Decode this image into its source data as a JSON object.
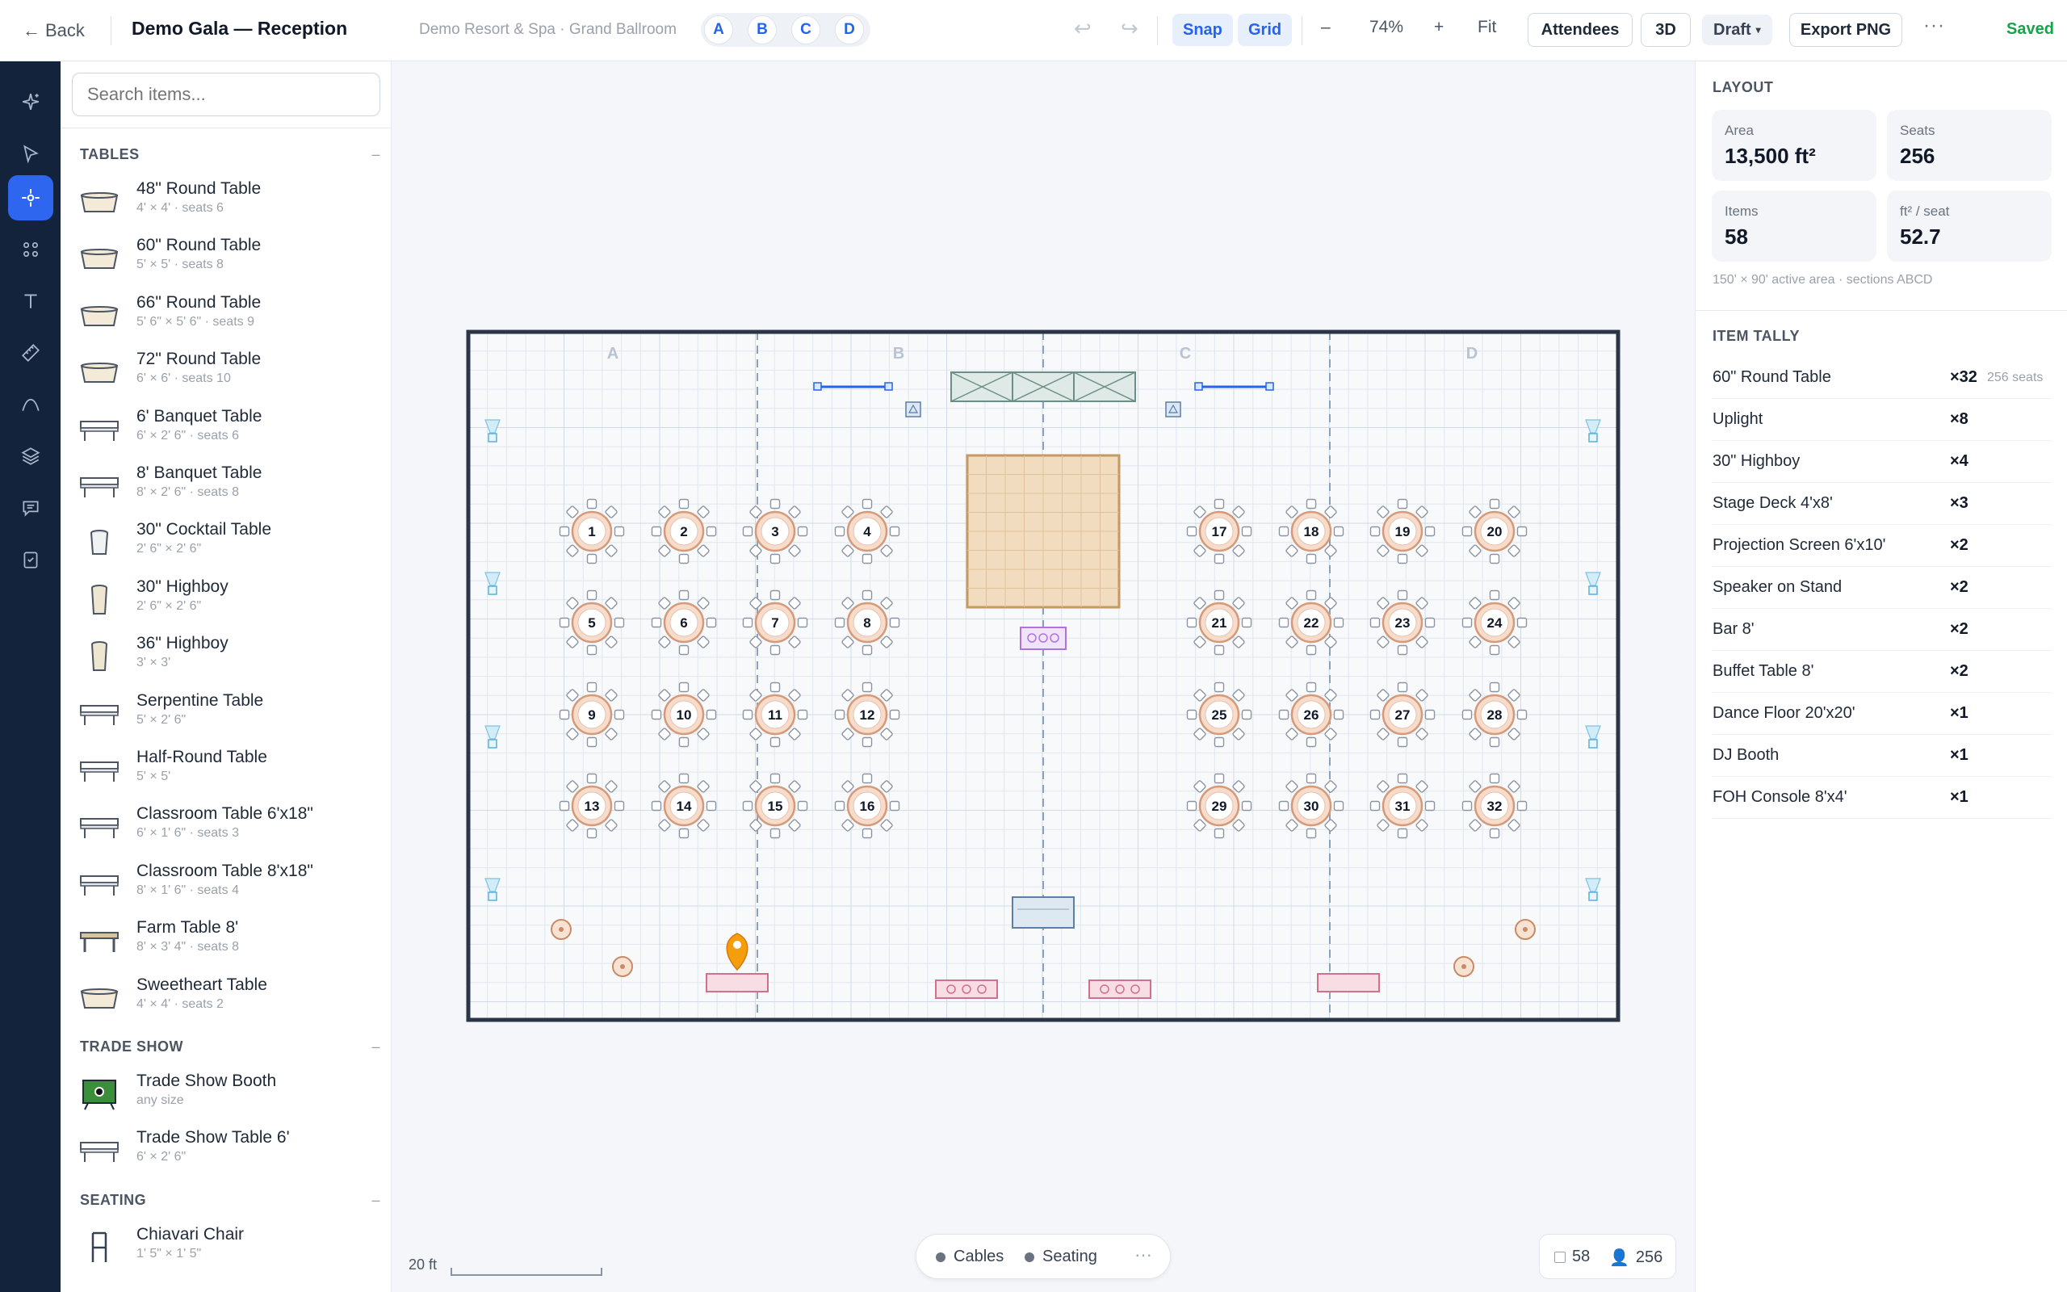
{
  "topbar": {
    "back_label": "Back",
    "title": "Demo Gala — Reception",
    "venue": "Demo Resort & Spa · Grand Ballroom",
    "sections": [
      "A",
      "B",
      "C",
      "D"
    ],
    "snap_label": "Snap",
    "grid_label": "Grid",
    "zoom_out": "–",
    "zoom_level": "74%",
    "zoom_in": "+",
    "fit_label": "Fit",
    "attendees_label": "Attendees",
    "view3d_label": "3D",
    "status_label": "Draft",
    "export_label": "Export PNG",
    "more": "···",
    "saved_label": "Saved"
  },
  "rail": {
    "items": [
      {
        "icon": "sparkle-icon",
        "active": false
      },
      {
        "icon": "cursor-icon",
        "active": false
      },
      {
        "icon": "items-icon",
        "active": true
      },
      {
        "icon": "groups-icon",
        "active": false
      },
      {
        "icon": "text-icon",
        "active": false
      },
      {
        "icon": "measure-icon",
        "active": false
      },
      {
        "icon": "path-icon",
        "active": false
      },
      {
        "icon": "layers-icon",
        "active": false
      },
      {
        "icon": "comments-icon",
        "active": false
      },
      {
        "icon": "checklist-icon",
        "active": false
      }
    ]
  },
  "library": {
    "search_placeholder": "Search items...",
    "categories": [
      {
        "name": "TABLES",
        "items": [
          {
            "name": "48\" Round Table",
            "sub": "4' × 4' · seats 6",
            "icon": "round"
          },
          {
            "name": "60\" Round Table",
            "sub": "5' × 5' · seats 8",
            "icon": "round"
          },
          {
            "name": "66\" Round Table",
            "sub": "5' 6\" × 5' 6\" · seats 9",
            "icon": "round"
          },
          {
            "name": "72\" Round Table",
            "sub": "6' × 6' · seats 10",
            "icon": "round"
          },
          {
            "name": "6' Banquet Table",
            "sub": "6' × 2' 6\" · seats 6",
            "icon": "banquet"
          },
          {
            "name": "8' Banquet Table",
            "sub": "8' × 2' 6\" · seats 8",
            "icon": "banquet"
          },
          {
            "name": "30\" Cocktail Table",
            "sub": "2' 6\" × 2' 6\"",
            "icon": "cocktail"
          },
          {
            "name": "30\" Highboy",
            "sub": "2' 6\" × 2' 6\"",
            "icon": "highboy"
          },
          {
            "name": "36\" Highboy",
            "sub": "3' × 3'",
            "icon": "highboy"
          },
          {
            "name": "Serpentine Table",
            "sub": "5' × 2' 6\"",
            "icon": "banquet"
          },
          {
            "name": "Half-Round Table",
            "sub": "5' × 5'",
            "icon": "banquet"
          },
          {
            "name": "Classroom Table 6'x18\"",
            "sub": "6' × 1' 6\" · seats 3",
            "icon": "banquet"
          },
          {
            "name": "Classroom Table 8'x18\"",
            "sub": "8' × 1' 6\" · seats 4",
            "icon": "banquet"
          },
          {
            "name": "Farm Table 8'",
            "sub": "8' × 3' 4\" · seats 8",
            "icon": "farm"
          },
          {
            "name": "Sweetheart Table",
            "sub": "4' × 4' · seats 2",
            "icon": "round"
          }
        ]
      },
      {
        "name": "TRADE SHOW",
        "items": [
          {
            "name": "Trade Show Booth",
            "sub": "any size",
            "icon": "booth"
          },
          {
            "name": "Trade Show Table 6'",
            "sub": "6' × 2' 6\"",
            "icon": "banquet"
          }
        ]
      },
      {
        "name": "SEATING",
        "items": [
          {
            "name": "Chiavari Chair",
            "sub": "1' 5\" × 1' 5\"",
            "icon": "chair"
          }
        ]
      }
    ],
    "collapse_glyph": "–"
  },
  "layout_stats": {
    "heading": "LAYOUT",
    "area_label": "Area",
    "area_value": "13,500 ft²",
    "seats_label": "Seats",
    "seats_value": "256",
    "items_label": "Items",
    "items_value": "58",
    "density_label": "ft² / seat",
    "density_value": "52.7",
    "note": "150' × 90' active area · sections ABCD"
  },
  "tally": {
    "heading": "ITEM TALLY",
    "rows": [
      {
        "name": "60\" Round Table",
        "count": "×32",
        "extra": "256 seats"
      },
      {
        "name": "Uplight",
        "count": "×8",
        "extra": ""
      },
      {
        "name": "30\" Highboy",
        "count": "×4",
        "extra": ""
      },
      {
        "name": "Stage Deck 4'x8'",
        "count": "×3",
        "extra": ""
      },
      {
        "name": "Projection Screen 6'x10'",
        "count": "×2",
        "extra": ""
      },
      {
        "name": "Speaker on Stand",
        "count": "×2",
        "extra": ""
      },
      {
        "name": "Bar 8'",
        "count": "×2",
        "extra": ""
      },
      {
        "name": "Buffet Table 8'",
        "count": "×2",
        "extra": ""
      },
      {
        "name": "Dance Floor 20'x20'",
        "count": "×1",
        "extra": ""
      },
      {
        "name": "DJ Booth",
        "count": "×1",
        "extra": ""
      },
      {
        "name": "FOH Console 8'x4'",
        "count": "×1",
        "extra": ""
      }
    ]
  },
  "floorplan": {
    "section_labels": [
      "A",
      "B",
      "C",
      "D"
    ],
    "table_numbers": [
      "1",
      "2",
      "3",
      "4",
      "5",
      "6",
      "7",
      "8",
      "9",
      "10",
      "11",
      "12",
      "13",
      "14",
      "15",
      "16",
      "17",
      "18",
      "19",
      "20",
      "21",
      "22",
      "23",
      "24",
      "25",
      "26",
      "27",
      "28",
      "29",
      "30",
      "31",
      "32"
    ]
  },
  "canvas_footer": {
    "scale_label": "20 ft",
    "cables_label": "Cables",
    "seating_label": "Seating",
    "more": "···",
    "items_count": "58",
    "seats_count": "256"
  }
}
